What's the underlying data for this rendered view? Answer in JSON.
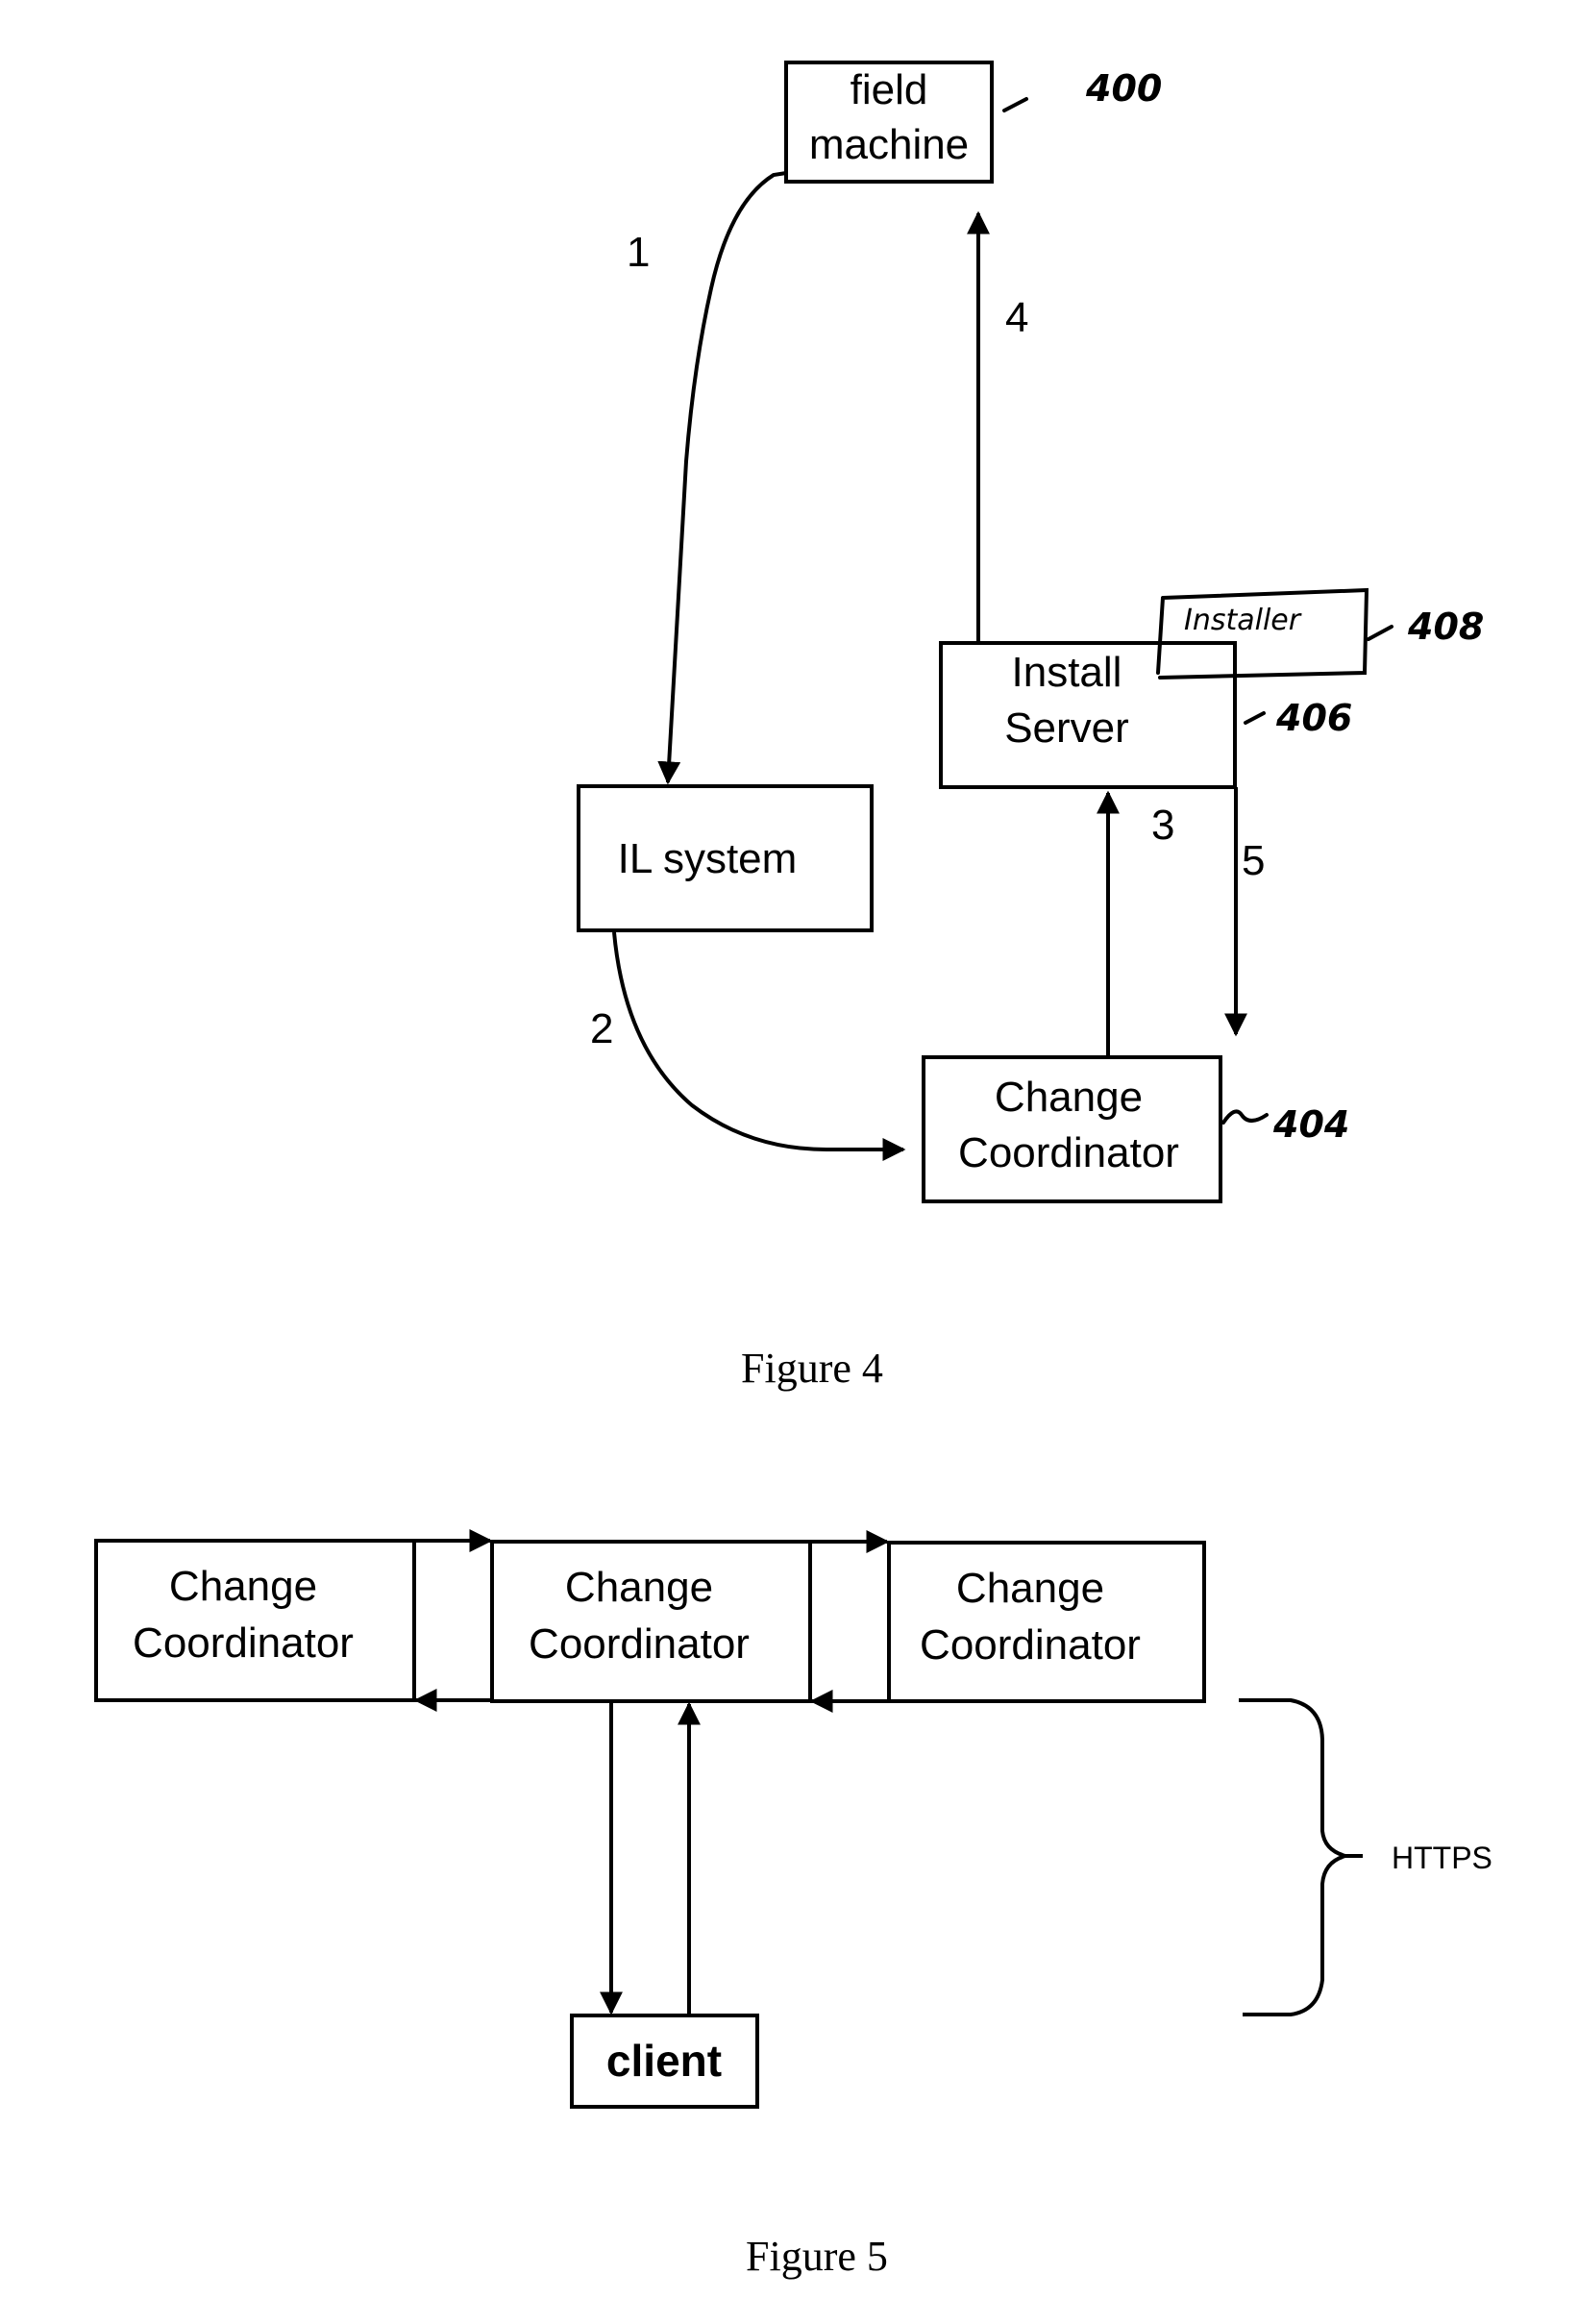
{
  "figure4": {
    "caption": "Figure 4",
    "nodes": {
      "field_machine": {
        "line1": "field",
        "line2": "machine",
        "ref": "400"
      },
      "install_server": {
        "line1": "Install",
        "line2": "Server",
        "ref": "406"
      },
      "installer": {
        "label": "Installer",
        "ref": "408"
      },
      "il_system": {
        "label": "IL system"
      },
      "change_coordinator": {
        "line1": "Change",
        "line2": "Coordinator",
        "ref": "404"
      }
    },
    "flows": [
      {
        "step": "1",
        "from": "field machine",
        "to": "IL system"
      },
      {
        "step": "2",
        "from": "IL system",
        "to": "Change Coordinator"
      },
      {
        "step": "3",
        "from": "Change Coordinator",
        "to": "Install Server"
      },
      {
        "step": "4",
        "from": "Install Server",
        "to": "field machine"
      },
      {
        "step": "5",
        "from": "Install Server",
        "to": "Change Coordinator"
      }
    ]
  },
  "figure5": {
    "caption": "Figure 5",
    "coordinators": [
      {
        "line1": "Change",
        "line2": "Coordinator"
      },
      {
        "line1": "Change",
        "line2": "Coordinator"
      },
      {
        "line1": "Change",
        "line2": "Coordinator"
      }
    ],
    "client": {
      "label": "client"
    },
    "protocol": "HTTPS"
  }
}
